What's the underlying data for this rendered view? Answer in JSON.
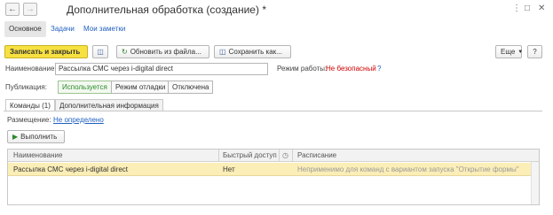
{
  "window": {
    "title": "Дополнительная обработка (создание) *",
    "nav_back_icon": "arrow-left-icon",
    "nav_forward_icon": "arrow-right-icon",
    "menu_icon": "more-icon",
    "maximize_icon": "maximize-icon",
    "close_icon": "close-icon"
  },
  "tabs": {
    "main": "Основное",
    "tasks": "Задачи",
    "notes": "Мои заметки"
  },
  "toolbar": {
    "save_close": "Записать и закрыть",
    "update_from_file": "Обновить из файла...",
    "save_as": "Сохранить как...",
    "more": "Еще",
    "help": "?"
  },
  "form": {
    "name_label": "Наименование:",
    "name_value": "Рассылка СМС через i-digital direct",
    "mode_label": "Режим работы:",
    "mode_value": "Не безопасный",
    "mode_help": "?",
    "publication_label": "Публикация:",
    "publication_options": [
      "Используется",
      "Режим отладки",
      "Отключена"
    ],
    "publication_selected": "Используется"
  },
  "subtabs": {
    "commands": "Команды (1)",
    "additional_info": "Дополнительная информация"
  },
  "commands_panel": {
    "placement_label": "Размещение:",
    "placement_value": "Не определено",
    "run_button": "Выполнить"
  },
  "table": {
    "columns": [
      "Наименование",
      "Быстрый доступ",
      "Расписание"
    ],
    "rows": [
      {
        "name": "Рассылка СМС через i-digital direct",
        "quick_access": "Нет",
        "schedule": "Неприменимо для команд с вариантом запуска \"Открытие формы\""
      }
    ]
  },
  "colors": {
    "primary_button": "#f7e141",
    "selected_row": "#fbeeb7",
    "link": "#1f5fbf",
    "warning": "#d00000",
    "active_publication": "#2a8a2a"
  }
}
